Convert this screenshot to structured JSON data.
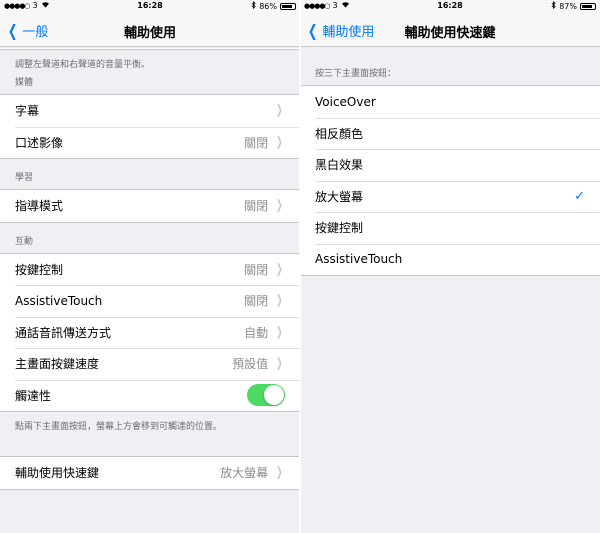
{
  "left_screen": {
    "status": {
      "carrier": "3",
      "time": "16:28",
      "battery": "86%",
      "battery_level": 0.86
    },
    "nav": {
      "back_label": "一般",
      "title": "輔助使用"
    },
    "top_note": "調整左聲道和右聲道的音量平衡。",
    "sections": {
      "media": {
        "header": "媒體",
        "rows": [
          {
            "label": "字幕",
            "value": ""
          },
          {
            "label": "口述影像",
            "value": "關閉"
          }
        ]
      },
      "learning": {
        "header": "學習",
        "rows": [
          {
            "label": "指導模式",
            "value": "關閉"
          }
        ]
      },
      "interaction": {
        "header": "互動",
        "rows": [
          {
            "label": "按鍵控制",
            "value": "關閉"
          },
          {
            "label": "AssistiveTouch",
            "value": "關閉"
          },
          {
            "label": "通話音訊傳送方式",
            "value": "自動"
          },
          {
            "label": "主畫面按鍵速度",
            "value": "預設值"
          },
          {
            "label": "觸達性",
            "toggle": "on"
          }
        ],
        "footer": "點兩下主畫面按鈕，螢幕上方會移到可觸達的位置。"
      },
      "shortcut": {
        "rows": [
          {
            "label": "輔助使用快速鍵",
            "value": "放大螢幕"
          }
        ]
      }
    }
  },
  "right_screen": {
    "status": {
      "carrier": "3",
      "time": "16:28",
      "battery": "87%",
      "battery_level": 0.87
    },
    "nav": {
      "back_label": "輔助使用",
      "title": "輔助使用快速鍵"
    },
    "header": "按三下主畫面按鈕：",
    "options": [
      {
        "label": "VoiceOver",
        "checked": false
      },
      {
        "label": "相反顏色",
        "checked": false
      },
      {
        "label": "黑白效果",
        "checked": false
      },
      {
        "label": "放大螢幕",
        "checked": true
      },
      {
        "label": "按鍵控制",
        "checked": false
      },
      {
        "label": "AssistiveTouch",
        "checked": false
      }
    ]
  },
  "icons": {
    "back": "chevron-left-icon",
    "disclosure": "chevron-right-icon",
    "check": "checkmark-icon",
    "wifi": "wifi-icon",
    "bluetooth": "bluetooth-icon",
    "battery": "battery-icon"
  },
  "colors": {
    "accent": "#007aff",
    "toggle_on": "#4cd964",
    "background": "#efeff4"
  }
}
